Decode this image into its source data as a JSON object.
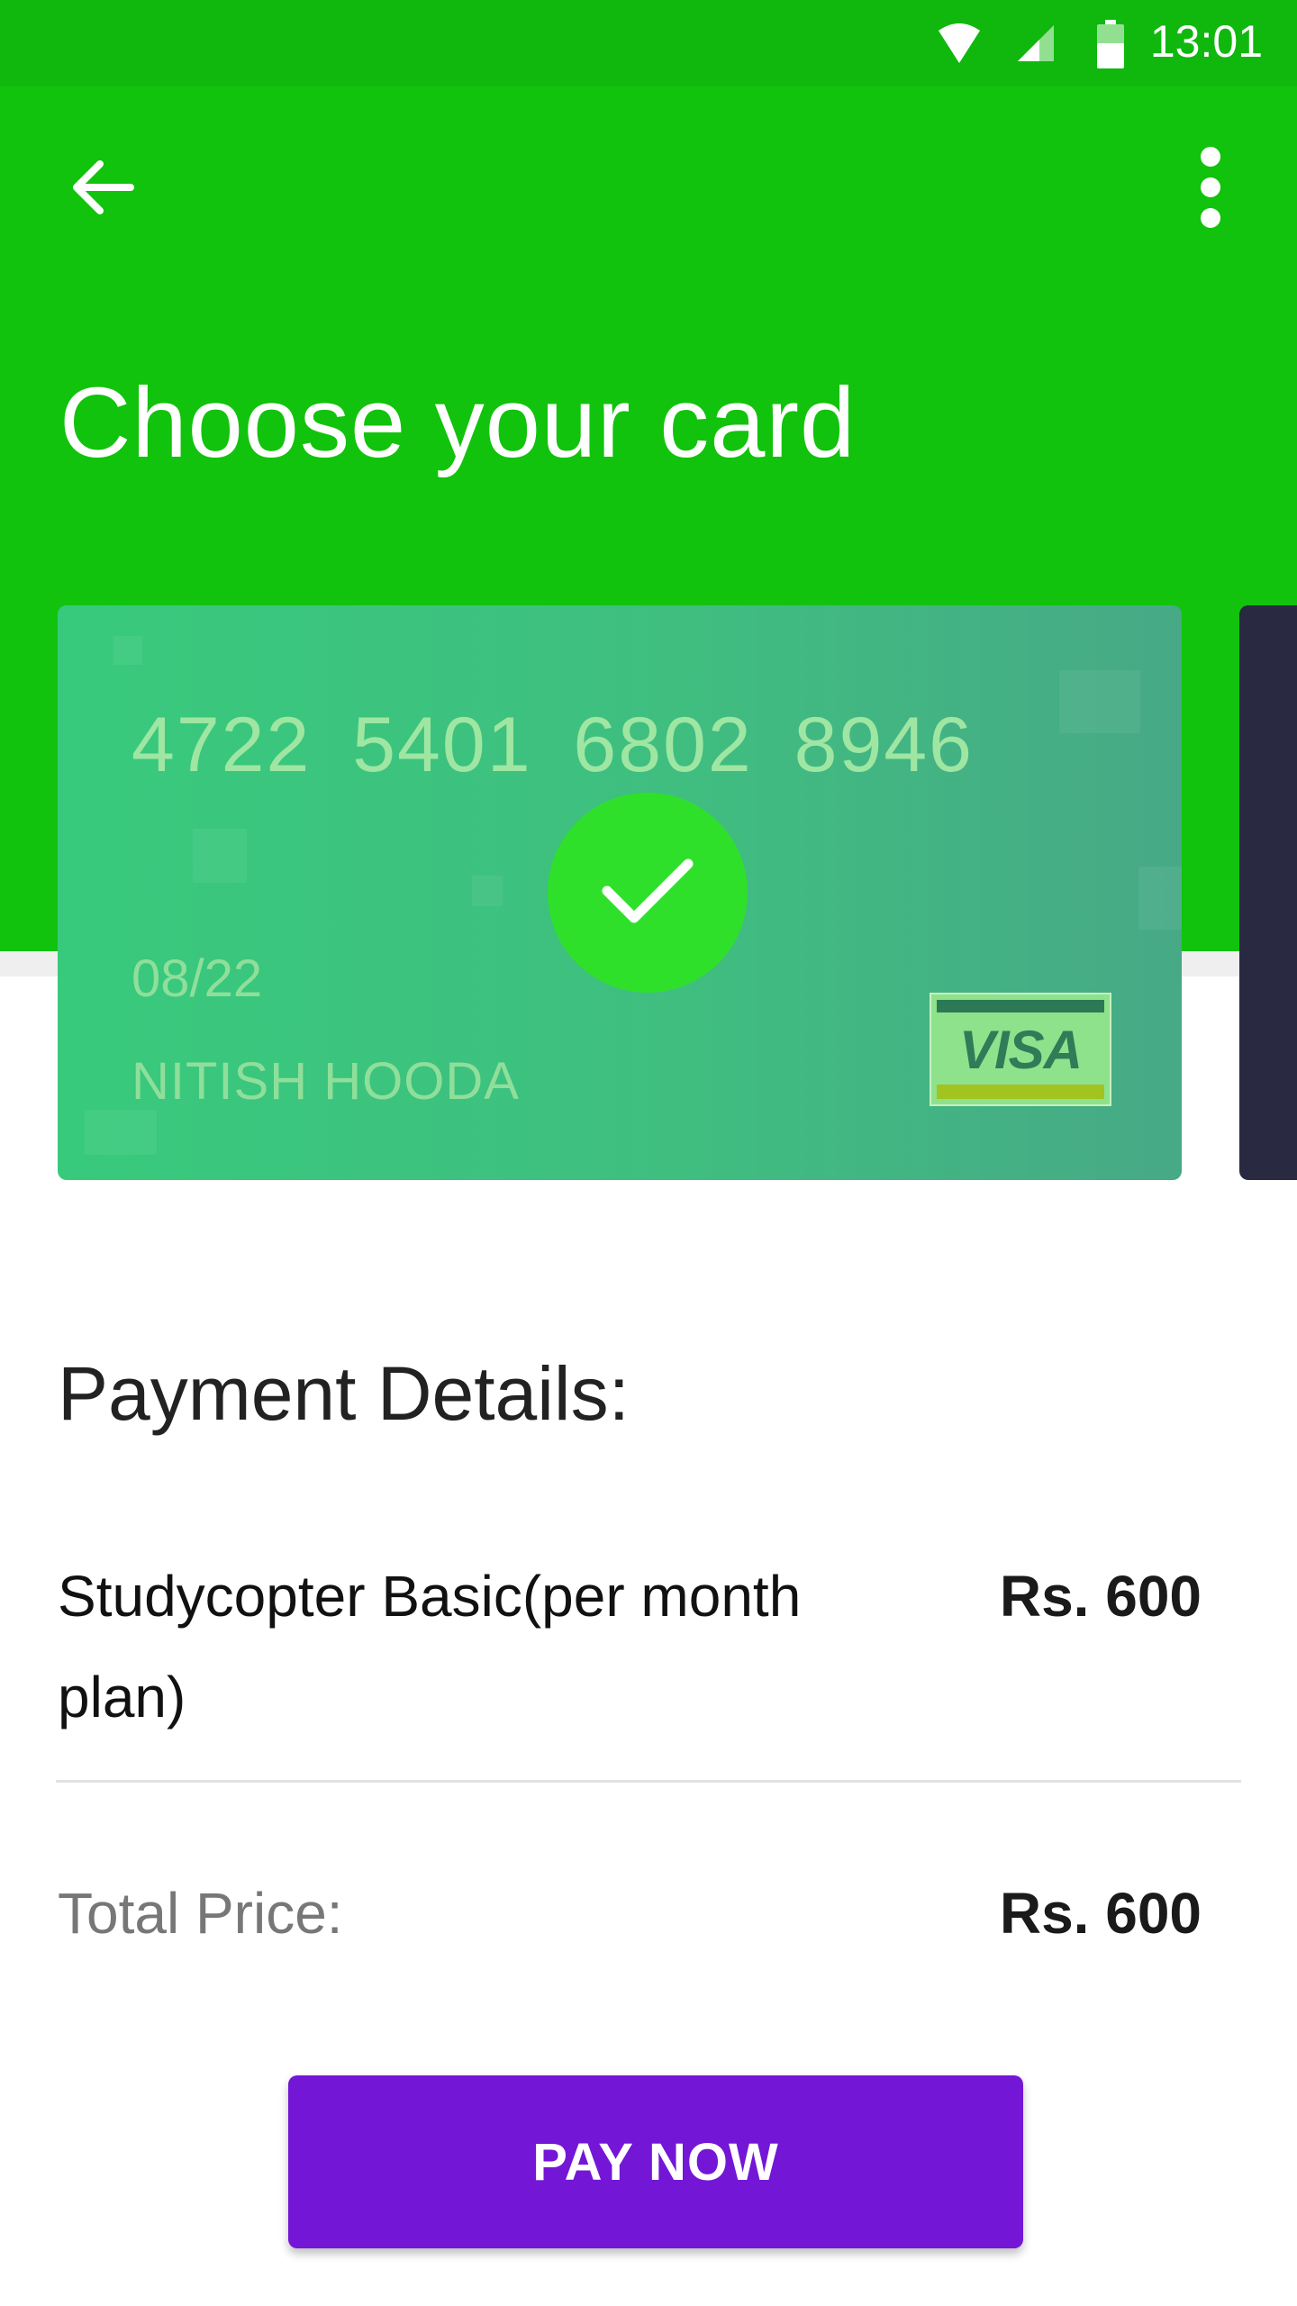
{
  "status_bar": {
    "time": "13:01",
    "icons": [
      "wifi-icon",
      "cell-signal-icon",
      "battery-icon"
    ]
  },
  "app_bar": {
    "back_icon": "arrow-left-icon",
    "menu_icon": "more-vert-icon",
    "title": "Choose your card"
  },
  "card": {
    "number": "4722  5401  6802  8946",
    "expiry": "08/22",
    "holder": "NITISH HOODA",
    "brand": "VISA",
    "selected": true,
    "selected_icon": "checkmark-icon"
  },
  "payment": {
    "heading": "Payment Details:",
    "item_name": "Studycopter Basic(per month plan)",
    "item_price": "Rs. 600",
    "total_label": "Total Price:",
    "total_price": "Rs. 600"
  },
  "actions": {
    "pay_label": "PAY NOW"
  },
  "colors": {
    "primary_green": "#11c30c",
    "status_green": "#10b80e",
    "card_green": "#3fbe80",
    "check_green": "#2fe02b",
    "accent_purple": "#7316d6",
    "next_card_dark": "#2a2942"
  }
}
